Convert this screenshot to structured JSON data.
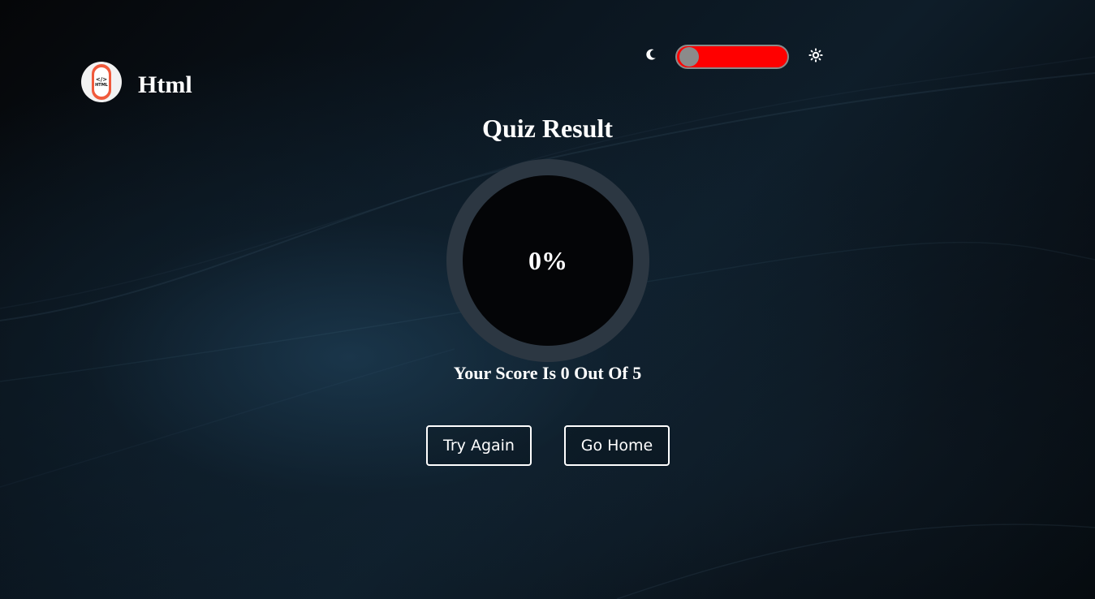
{
  "brand": {
    "logo_code": "</>",
    "logo_word": "HTML",
    "title": "Html"
  },
  "theme_toggle": {
    "moon_icon": "moon-icon",
    "sun_icon": "sun-icon",
    "track_color": "#ff0000",
    "knob_color": "#8b8b8b",
    "state": "dark"
  },
  "result": {
    "title": "Quiz Result",
    "percent_text": "0%",
    "percent_value": 0,
    "score_text": "Your Score Is 0 Out Of 5"
  },
  "actions": {
    "try_again_label": "Try Again",
    "go_home_label": "Go Home"
  },
  "colors": {
    "accent_logo": "#f05a3c",
    "ring_track": "#2c3742",
    "ring_center": "#040507",
    "text": "#ffffff"
  }
}
